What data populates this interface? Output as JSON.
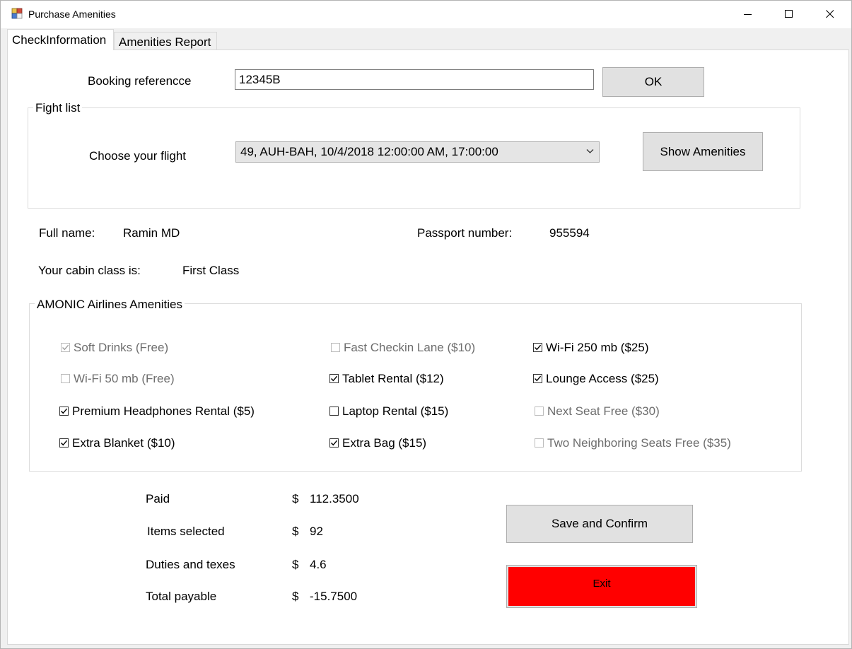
{
  "window": {
    "title": "Purchase Amenities",
    "controls": {
      "minimize_icon": "minimize-icon",
      "maximize_icon": "maximize-icon",
      "close_icon": "close-icon"
    }
  },
  "tabs": [
    {
      "label": "CheckInformation",
      "active": true
    },
    {
      "label": "Amenities Report",
      "active": false
    }
  ],
  "booking": {
    "label": "Booking referencce",
    "value": "12345B",
    "ok_label": "OK"
  },
  "flight_group": {
    "caption": "Fight list",
    "choose_label": "Choose your flight",
    "selected_flight": "49, AUH-BAH, 10/4/2018 12:00:00 AM, 17:00:00",
    "show_button": "Show Amenities"
  },
  "passenger": {
    "full_name_label": "Full name:",
    "full_name": "Ramin MD",
    "passport_label": "Passport number:",
    "passport": "955594",
    "cabin_label": "Your cabin class is:",
    "cabin": "First Class"
  },
  "amenities": {
    "caption": "AMONIC Airlines Amenities",
    "items": [
      {
        "label": "Soft Drinks (Free)",
        "checked": true,
        "enabled": false
      },
      {
        "label": "Wi-Fi 50 mb (Free)",
        "checked": false,
        "enabled": false
      },
      {
        "label": "Premium Headphones Rental ($5)",
        "checked": true,
        "enabled": true
      },
      {
        "label": "Extra Blanket ($10)",
        "checked": true,
        "enabled": true
      },
      {
        "label": "Fast Checkin Lane ($10)",
        "checked": false,
        "enabled": false
      },
      {
        "label": "Tablet Rental ($12)",
        "checked": true,
        "enabled": true
      },
      {
        "label": "Laptop Rental ($15)",
        "checked": false,
        "enabled": true
      },
      {
        "label": "Extra Bag ($15)",
        "checked": true,
        "enabled": true
      },
      {
        "label": "Wi-Fi 250 mb ($25)",
        "checked": true,
        "enabled": true
      },
      {
        "label": "Lounge Access ($25)",
        "checked": true,
        "enabled": true
      },
      {
        "label": "Next Seat Free ($30)",
        "checked": false,
        "enabled": false
      },
      {
        "label": "Two Neighboring Seats Free ($35)",
        "checked": false,
        "enabled": false
      }
    ]
  },
  "summary": {
    "currency": "$",
    "rows": [
      {
        "label": "Paid",
        "value": "112.3500"
      },
      {
        "label": "Items selected",
        "value": "92"
      },
      {
        "label": "Duties and texes",
        "value": "4.6"
      },
      {
        "label": "Total payable",
        "value": "-15.7500"
      }
    ]
  },
  "actions": {
    "save_label": "Save and Confirm",
    "exit_label": "Exit",
    "exit_color": "#ff0000"
  }
}
